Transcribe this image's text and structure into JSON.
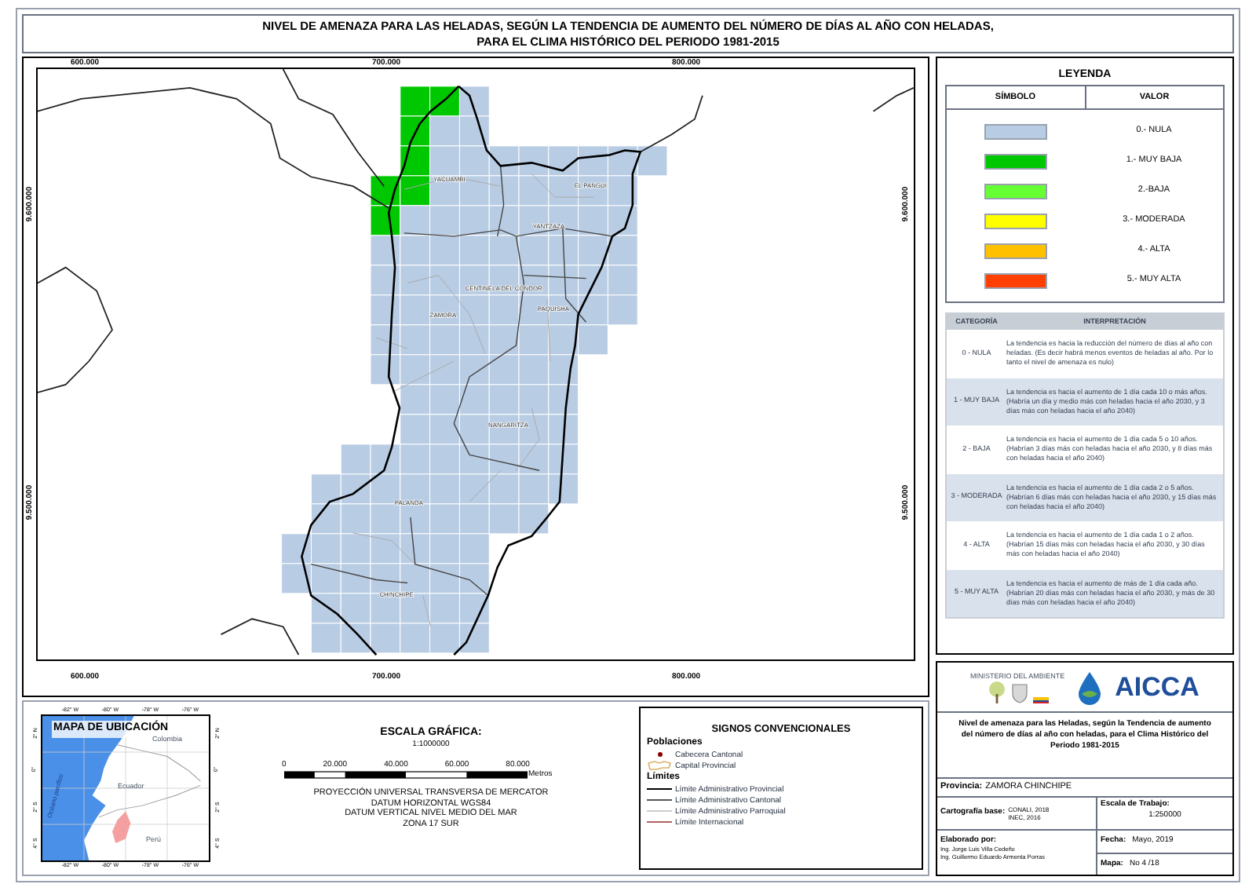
{
  "title_lines": [
    "NIVEL DE AMENAZA PARA LAS HELADAS, SEGÚN LA TENDENCIA DE AUMENTO DEL NÚMERO DE DÍAS AL AÑO CON HELADAS,",
    "PARA EL CLIMA HISTÓRICO DEL PERIODO 1981-2015"
  ],
  "map": {
    "top_coordinates": [
      "600.000",
      "700.000",
      "800.000"
    ],
    "bottom_coordinates": [
      "600.000",
      "700.000",
      "800.000"
    ],
    "left_coordinates": [
      "9.600.000",
      "9.500.000"
    ],
    "right_coordinates": [
      "9.600.000",
      "9.500.000"
    ],
    "place_labels": [
      "YACUAMBI",
      "EL PANGUI",
      "YANTZAZA",
      "CENTINELA DEL CÓNDOR",
      "PAQUISHA",
      "ZAMORA",
      "NANGARITZA",
      "PALANDA",
      "CHINCHIPE"
    ]
  },
  "legend": {
    "title": "LEYENDA",
    "columns": [
      "SÍMBOLO",
      "VALOR"
    ],
    "items": [
      {
        "label": "0.- NULA",
        "color": "#b8cce4"
      },
      {
        "label": "1.- MUY BAJA",
        "color": "#00c800"
      },
      {
        "label": "2.-BAJA",
        "color": "#66ff33"
      },
      {
        "label": "3.- MODERADA",
        "color": "#ffff00"
      },
      {
        "label": "4.- ALTA",
        "color": "#ffc000"
      },
      {
        "label": "5.- MUY ALTA",
        "color": "#ff4000"
      }
    ]
  },
  "interpretation": {
    "columns": [
      "CATEGORÍA",
      "INTERPRETACIÓN"
    ],
    "rows": [
      {
        "category": "0 - NULA",
        "text": "La tendencia es hacia la reducción del número de días al año con heladas. (Es decir habrá menos eventos de heladas al año. Por lo tanto el nivel de amenaza es nulo)"
      },
      {
        "category": "1 - MUY BAJA",
        "text": "La tendencia es hacia el aumento de 1 día cada 10 o más años. (Habría un día y medio más con heladas hacia el año 2030, y 3 días más con heladas hacia el año 2040)"
      },
      {
        "category": "2 - BAJA",
        "text": "La tendencia es hacia el aumento de 1 día cada 5 o 10 años. (Habrían 3 días más con heladas hacia el año 2030, y 8 días más con heladas hacia el año 2040)"
      },
      {
        "category": "3 - MODERADA",
        "text": "La tendencia es hacia el aumento de 1 día cada 2 o 5 años. (Habrían 6 días más con heladas hacia el año 2030, y 15 días más con heladas hacia el año 2040)"
      },
      {
        "category": "4 - ALTA",
        "text": "La tendencia es hacia el aumento de 1 día cada 1 o 2 años. (Habrían 15 días más con heladas hacia el año 2030, y 30 días más con heladas hacia el año 2040)"
      },
      {
        "category": "5 - MUY ALTA",
        "text": "La tendencia es hacia el aumento de más de 1 día cada año. (Habrían 20 días más con heladas hacia el año 2030, y más de 30 días más con heladas hacia el año 2040)"
      }
    ]
  },
  "location_map": {
    "title": "MAPA DE UBICACIÓN",
    "top_longitudes": [
      "-82° W",
      "-80° W",
      "-78° W",
      "-76° W"
    ],
    "bottom_longitudes": [
      "-82° W",
      "-80° W",
      "-78° W",
      "-76° W"
    ],
    "left_latitudes": [
      "2° N",
      "0°",
      "2° S",
      "4° S"
    ],
    "right_latitudes": [
      "2° N",
      "0°",
      "2° S",
      "4° S"
    ],
    "ocean": "Océano pacífico",
    "countries": [
      "Colombia",
      "Ecuador",
      "Perú"
    ]
  },
  "scale": {
    "title": "ESCALA GRÁFICA:",
    "ratio": "1:1000000",
    "ticks": [
      "0",
      "20.000",
      "40.000",
      "60.000",
      "80.000"
    ],
    "unit": "Metros",
    "projection_lines": [
      "PROYECCIÓN UNIVERSAL TRANSVERSA DE MERCATOR",
      "DATUM HORIZONTAL WGS84",
      "DATUM VERTICAL NIVEL MEDIO DEL MAR",
      "ZONA 17 SUR"
    ]
  },
  "signs": {
    "title": "SIGNOS CONVENCIONALES",
    "groups": [
      {
        "title": "Poblaciones",
        "items": [
          {
            "kind": "dot",
            "label": "Cabecera Cantonal",
            "color": "#8b0000"
          },
          {
            "kind": "outline",
            "label": "Capital Provincial",
            "color": "#d9b26a"
          }
        ]
      },
      {
        "title": "Límites",
        "items": [
          {
            "kind": "line",
            "label": "Límite Administrativo Provincial",
            "color": "#000000"
          },
          {
            "kind": "line",
            "label": "Límite Administrativo Cantonal",
            "color": "#555555"
          },
          {
            "kind": "line",
            "label": "Límite Administrativo Parroquial",
            "color": "#cccccc"
          },
          {
            "kind": "line",
            "label": "Límite Internacional",
            "color": "#b06060"
          }
        ]
      }
    ]
  },
  "title_block": {
    "ministry": "MINISTERIO DEL AMBIENTE",
    "logo_text": "AICCA",
    "description": "Nivel de amenaza para las Heladas, según la Tendencia de aumento del número de días al año con heladas, para el Clima Histórico del Periodo 1981-2015",
    "province_label": "Provincia:",
    "province": "ZAMORA CHINCHIPE",
    "base_label": "Cartografía base:",
    "base_sources": [
      "CONALI, 2018",
      "INEC, 2016"
    ],
    "scale_label": "Escala de Trabajo:",
    "scale": "1:250000",
    "author_label": "Elaborado por:",
    "authors": [
      "Ing. Jorge Luis Villa Cedeño",
      "Ing. Guillermo Eduardo Armenta Porras"
    ],
    "date_label": "Fecha:",
    "date": "Mayo, 2019",
    "map_label": "Mapa:",
    "map_number": "No 4 /18"
  }
}
